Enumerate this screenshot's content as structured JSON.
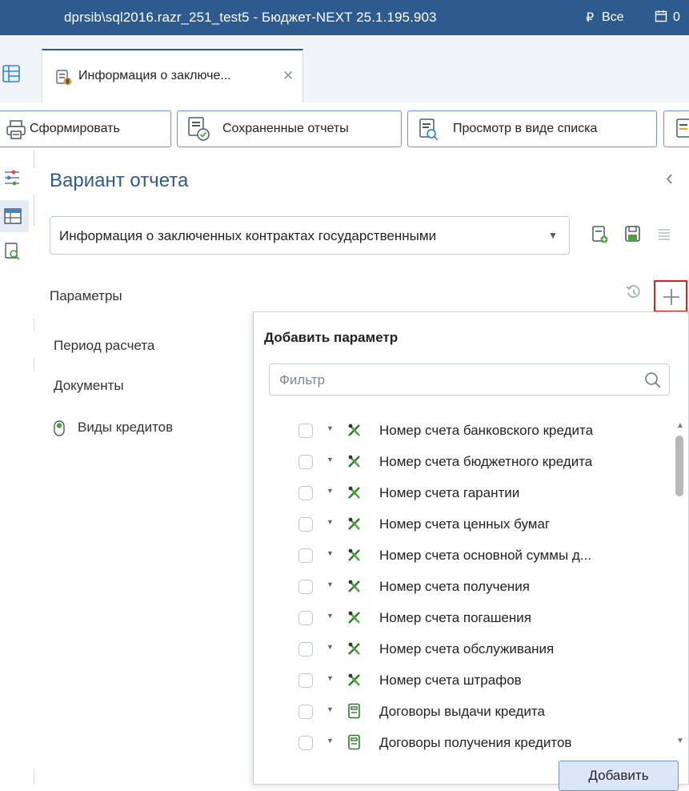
{
  "window": {
    "title": "dprsib\\sql2016.razr_251_test5 - Бюджет-NEXT 25.1.195.903",
    "currency_label": "Все",
    "date_label": "0"
  },
  "tabs": [
    {
      "label": "Информация о заключе..."
    }
  ],
  "toolbar": {
    "generate_label": "Сформировать",
    "saved_reports_label": "Сохраненные отчеты",
    "list_view_label": "Просмотр в виде списка"
  },
  "report": {
    "heading": "Вариант отчета",
    "variant_value": "Информация о заключенных контрактах государственными"
  },
  "parameters": {
    "label": "Параметры",
    "items": [
      "Период расчета",
      "Документы",
      "Виды кредитов"
    ]
  },
  "add_param_popup": {
    "title": "Добавить параметр",
    "filter_placeholder": "Фильтр",
    "items": [
      {
        "label": "Номер счета банковского кредита",
        "icon": "account-field-icon"
      },
      {
        "label": "Номер счета бюджетного кредита",
        "icon": "account-field-icon"
      },
      {
        "label": "Номер счета гарантии",
        "icon": "account-field-icon"
      },
      {
        "label": "Номер счета ценных бумаг",
        "icon": "account-field-icon"
      },
      {
        "label": "Номер счета основной суммы д...",
        "icon": "account-field-icon"
      },
      {
        "label": "Номер счета получения",
        "icon": "account-field-icon"
      },
      {
        "label": "Номер счета погашения",
        "icon": "account-field-icon"
      },
      {
        "label": "Номер счета обслуживания",
        "icon": "account-field-icon"
      },
      {
        "label": "Номер счета штрафов",
        "icon": "account-field-icon"
      },
      {
        "label": "Договоры выдачи кредита",
        "icon": "document-list-icon"
      },
      {
        "label": "Договоры получения кредитов",
        "icon": "document-list-icon"
      }
    ],
    "add_button_label": "Добавить"
  },
  "colors": {
    "titlebar": "#2d5a8f",
    "accent": "#2d5a8f",
    "highlight_border": "#e21b1b",
    "button_border": "#6f97c6"
  }
}
